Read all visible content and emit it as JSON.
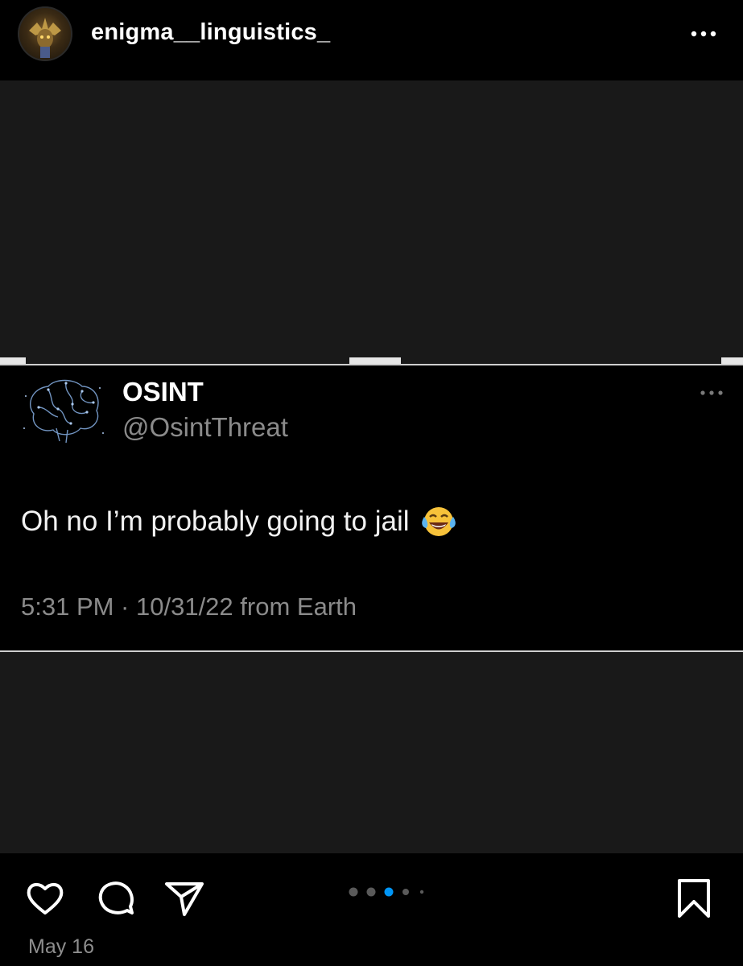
{
  "header": {
    "username": "enigma__linguistics_",
    "avatar_icon": "avatar-icon",
    "more_icon": "more-horizontal-icon"
  },
  "tweet": {
    "display_name": "OSINT",
    "handle": "@OsintThreat",
    "body": "Oh no I’m probably going to jail",
    "emoji_icon": "face-with-tears-of-joy-icon",
    "meta": "5:31 PM · 10/31/22 from Earth",
    "more_icon": "more-horizontal-icon"
  },
  "actions": {
    "like_icon": "heart-icon",
    "comment_icon": "comment-icon",
    "share_icon": "send-icon",
    "save_icon": "bookmark-icon",
    "carousel_total": 5,
    "carousel_active_index": 2,
    "date": "May 16"
  },
  "colors": {
    "background": "#000000",
    "post_surface": "#191919",
    "muted_text": "#8b8b8b",
    "active_dot": "#0095f6"
  }
}
